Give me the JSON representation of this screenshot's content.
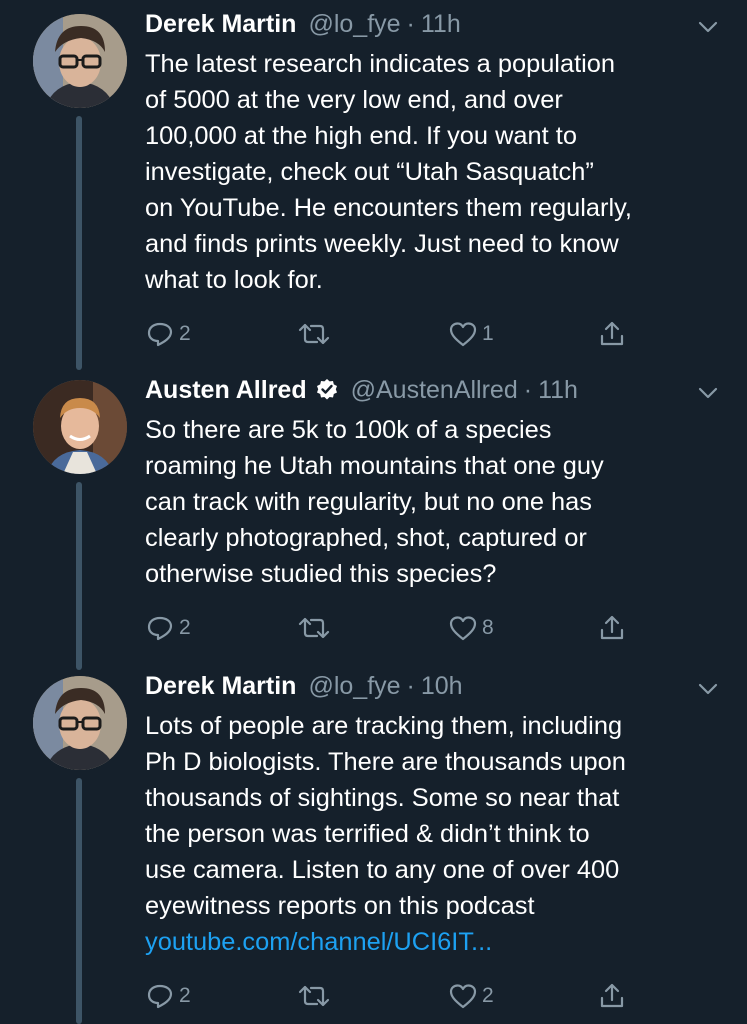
{
  "tweets": [
    {
      "name": "Derek Martin",
      "handle": "@lo_fye",
      "separator": "·",
      "time": "11h",
      "verified": false,
      "text": "The latest research indicates a population\nof 5000 at the very low end, and over\n100,000 at the high end. If you want to\ninvestigate, check out “Utah Sasquatch”\non YouTube. He encounters them regularly,\nand finds prints weekly. Just need to know\nwhat to look for.",
      "link": "",
      "replies": "2",
      "retweets": "",
      "likes": "1"
    },
    {
      "name": "Austen Allred",
      "handle": "@AustenAllred",
      "separator": "·",
      "time": "11h",
      "verified": true,
      "text": "So there are 5k to 100k of a species\nroaming he Utah mountains that one guy\ncan track with regularity, but no one has\nclearly photographed, shot, captured or\notherwise studied this species?",
      "link": "",
      "replies": "2",
      "retweets": "",
      "likes": "8"
    },
    {
      "name": "Derek Martin",
      "handle": "@lo_fye",
      "separator": "·",
      "time": "10h",
      "verified": false,
      "text": "Lots of people are tracking them, including\nPh D biologists. There are thousands upon\nthousands of sightings. Some so near that\nthe person was terrified & didn’t think to\nuse camera. Listen to any one of over 400\neyewitness reports on this podcast\n",
      "link": "youtube.com/channel/UCI6IT...",
      "replies": "2",
      "retweets": "",
      "likes": "2"
    }
  ],
  "colors": {
    "background": "#15202b",
    "text": "#ffffff",
    "muted": "#8899a6",
    "link": "#1da1f2",
    "thread_line": "#3d5466",
    "verified": "#ffffff"
  },
  "icons": {
    "reply": "reply-icon",
    "retweet": "retweet-icon",
    "like": "like-icon",
    "share": "share-icon",
    "caret": "chevron-down-icon",
    "verified": "verified-badge-icon"
  }
}
